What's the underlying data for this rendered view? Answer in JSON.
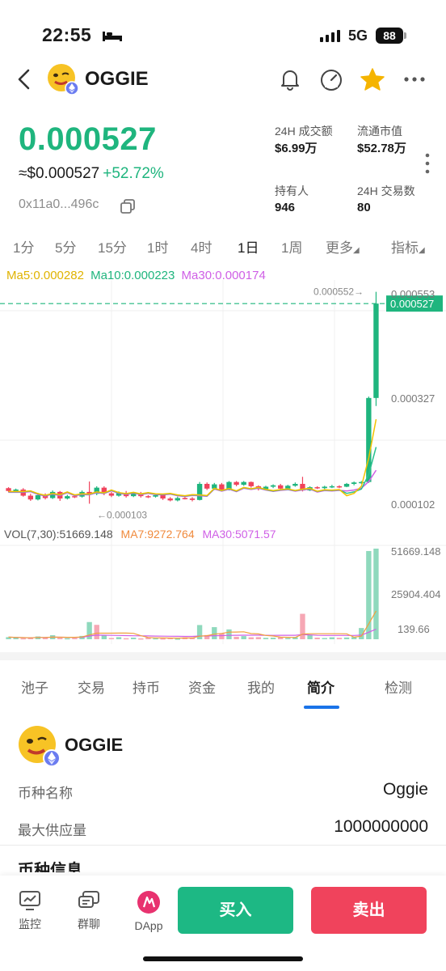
{
  "status_bar": {
    "time": "22:55",
    "network": "5G",
    "battery": "88"
  },
  "header": {
    "token": "OGGIE"
  },
  "price": {
    "main": "0.000527",
    "usd": "≈$0.000527",
    "change": "+52.72%",
    "address": "0x11a0...496c"
  },
  "stats": [
    {
      "label": "24H 成交额",
      "value": "$6.99万"
    },
    {
      "label": "流通市值",
      "value": "$52.78万"
    },
    {
      "label": "持有人",
      "value": "946"
    },
    {
      "label": "24H 交易数",
      "value": "80"
    }
  ],
  "intervals": {
    "items": [
      "1分",
      "5分",
      "15分",
      "1时",
      "4时",
      "1日",
      "1周",
      "更多",
      "指标"
    ],
    "active": "1日"
  },
  "chart_data": {
    "type": "candlestick",
    "ma_legend": {
      "ma5": "Ma5:0.000282",
      "ma10": "Ma10:0.000223",
      "ma30": "Ma30:0.000174"
    },
    "vol_legend": {
      "vol": "VOL(7,30):51669.148",
      "ma7": "MA7:9272.764",
      "ma30": "MA30:5071.57"
    },
    "price_ticks": [
      "0.000553",
      "0.000327",
      "0.000102"
    ],
    "current_price_tag": "0.000527",
    "high_marker": "0.000552→",
    "low_marker": "←0.000103",
    "volume_ticks": [
      "51669.148",
      "25904.404",
      "139.66"
    ],
    "y_range": [
      9.7e-05,
      0.000553
    ],
    "vol_range": [
      0,
      51669.148
    ],
    "colors": {
      "up": "#1fb57e",
      "down": "#f0435c",
      "ma5": "#f2c200",
      "ma10": "#2ac08e",
      "ma30": "#cf5fe6"
    },
    "candles": [
      [
        0.000136,
        0.00013,
        0.000138,
        0.000127
      ],
      [
        0.00013,
        0.000133,
        0.000135,
        0.000128
      ],
      [
        0.000133,
        0.00012,
        0.000136,
        0.000118
      ],
      [
        0.00012,
        0.000112,
        0.000124,
        0.000109
      ],
      [
        0.000112,
        0.000121,
        0.000126,
        0.00011
      ],
      [
        0.000121,
        0.000115,
        0.000125,
        0.000112
      ],
      [
        0.000115,
        0.000128,
        0.000131,
        0.000113
      ],
      [
        0.000128,
        0.000114,
        0.00013,
        0.000109
      ],
      [
        0.000114,
        0.000119,
        0.000122,
        0.000112
      ],
      [
        0.000119,
        0.000118,
        0.000123,
        0.000115
      ],
      [
        0.000118,
        0.000128,
        0.000131,
        0.000116
      ],
      [
        0.000128,
        0.000124,
        0.00015,
        0.000103
      ],
      [
        0.000124,
        0.000137,
        0.00014,
        0.000121
      ],
      [
        0.000137,
        0.000125,
        0.00014,
        0.000121
      ],
      [
        0.000125,
        0.00012,
        0.000128,
        0.000117
      ],
      [
        0.00012,
        0.000126,
        0.000129,
        0.000118
      ],
      [
        0.000126,
        0.000119,
        0.00013,
        0.000116
      ],
      [
        0.000119,
        0.000125,
        0.000128,
        0.000117
      ],
      [
        0.000125,
        0.000119,
        0.000128,
        0.000116
      ],
      [
        0.000119,
        0.000118,
        0.000121,
        0.000115
      ],
      [
        0.000118,
        0.000121,
        0.000124,
        0.000116
      ],
      [
        0.000121,
        0.000114,
        0.000124,
        0.000111
      ],
      [
        0.000114,
        0.00011,
        0.000117,
        0.000108
      ],
      [
        0.00011,
        0.000115,
        0.000118,
        0.000108
      ],
      [
        0.000115,
        0.000114,
        0.000118,
        0.000112
      ],
      [
        0.000114,
        0.000111,
        0.000117,
        0.000108
      ],
      [
        0.000111,
        0.000145,
        0.000149,
        0.00011
      ],
      [
        0.000145,
        0.000135,
        0.000148,
        0.000132
      ],
      [
        0.000135,
        0.000144,
        0.000147,
        0.000132
      ],
      [
        0.000144,
        0.000133,
        0.000147,
        0.00013
      ],
      [
        0.000133,
        0.000149,
        0.000151,
        0.000131
      ],
      [
        0.000149,
        0.000143,
        0.000151,
        0.00014
      ],
      [
        0.000143,
        0.000149,
        0.000151,
        0.000141
      ],
      [
        0.000149,
        0.00014,
        0.00015,
        0.000137
      ],
      [
        0.00014,
        0.000134,
        0.000142,
        0.000131
      ],
      [
        0.000134,
        0.000139,
        0.000141,
        0.000132
      ],
      [
        0.000139,
        0.000142,
        0.000144,
        0.000136
      ],
      [
        0.000142,
        0.000135,
        0.000145,
        0.000133
      ],
      [
        0.000135,
        0.000141,
        0.000143,
        0.000133
      ],
      [
        0.000141,
        0.000145,
        0.000148,
        0.000139
      ],
      [
        0.000145,
        0.000131,
        0.00016,
        0.000129
      ],
      [
        0.000131,
        0.000138,
        0.00014,
        0.00013
      ],
      [
        0.000138,
        0.000136,
        0.00014,
        0.000134
      ],
      [
        0.000136,
        0.000139,
        0.000141,
        0.000134
      ],
      [
        0.000139,
        0.00014,
        0.000143,
        0.000136
      ],
      [
        0.00014,
        0.000139,
        0.000142,
        0.000136
      ],
      [
        0.000139,
        0.000145,
        0.000147,
        0.000138
      ],
      [
        0.000145,
        0.000148,
        0.00015,
        0.000142
      ],
      [
        0.000148,
        0.000149,
        0.000151,
        0.000145
      ],
      [
        0.000149,
        0.000327,
        0.00033,
        0.000147
      ],
      [
        0.000327,
        0.000527,
        0.000552,
        0.00031
      ]
    ],
    "volumes": [
      1200,
      900,
      600,
      700,
      1600,
      1100,
      2300,
      800,
      600,
      700,
      1900,
      9800,
      8200,
      2200,
      700,
      1200,
      600,
      900,
      500,
      1000,
      600,
      500,
      700,
      400,
      1100,
      900,
      8100,
      2400,
      6900,
      3400,
      5600,
      1400,
      1800,
      1100,
      1200,
      800,
      900,
      1100,
      700,
      1300,
      14500,
      2600,
      900,
      700,
      1100,
      800,
      1000,
      1300,
      6400,
      50300,
      51669
    ],
    "volume_up": [
      true,
      true,
      false,
      false,
      true,
      false,
      true,
      false,
      true,
      false,
      true,
      true,
      false,
      true,
      false,
      true,
      false,
      true,
      false,
      false,
      true,
      false,
      false,
      true,
      false,
      false,
      true,
      false,
      true,
      false,
      true,
      false,
      true,
      false,
      false,
      true,
      true,
      false,
      true,
      true,
      false,
      true,
      false,
      true,
      true,
      false,
      true,
      true,
      true,
      true,
      true
    ],
    "ma5_tail": [
      0.00012,
      0.000125,
      0.00014,
      0.0002,
      0.000282
    ],
    "ma10_tail": [
      0.000125,
      0.000128,
      0.000134,
      0.000165,
      0.000223
    ],
    "ma30_tail": [
      0.00013,
      0.000132,
      0.000136,
      0.00015,
      0.000174
    ]
  },
  "section_tabs": {
    "items": [
      "池子",
      "交易",
      "持币",
      "资金",
      "我的",
      "简介",
      "检测"
    ],
    "active": "简介"
  },
  "intro": {
    "name": "OGGIE",
    "rows": [
      {
        "label": "币种名称",
        "value": "Oggie"
      },
      {
        "label": "最大供应量",
        "value": "1000000000"
      }
    ],
    "next_section_title": "币种信息"
  },
  "bottom_bar": {
    "monitor": "监控",
    "group_chat": "群聊",
    "dapp": "DApp",
    "buy": "买入",
    "sell": "卖出"
  }
}
